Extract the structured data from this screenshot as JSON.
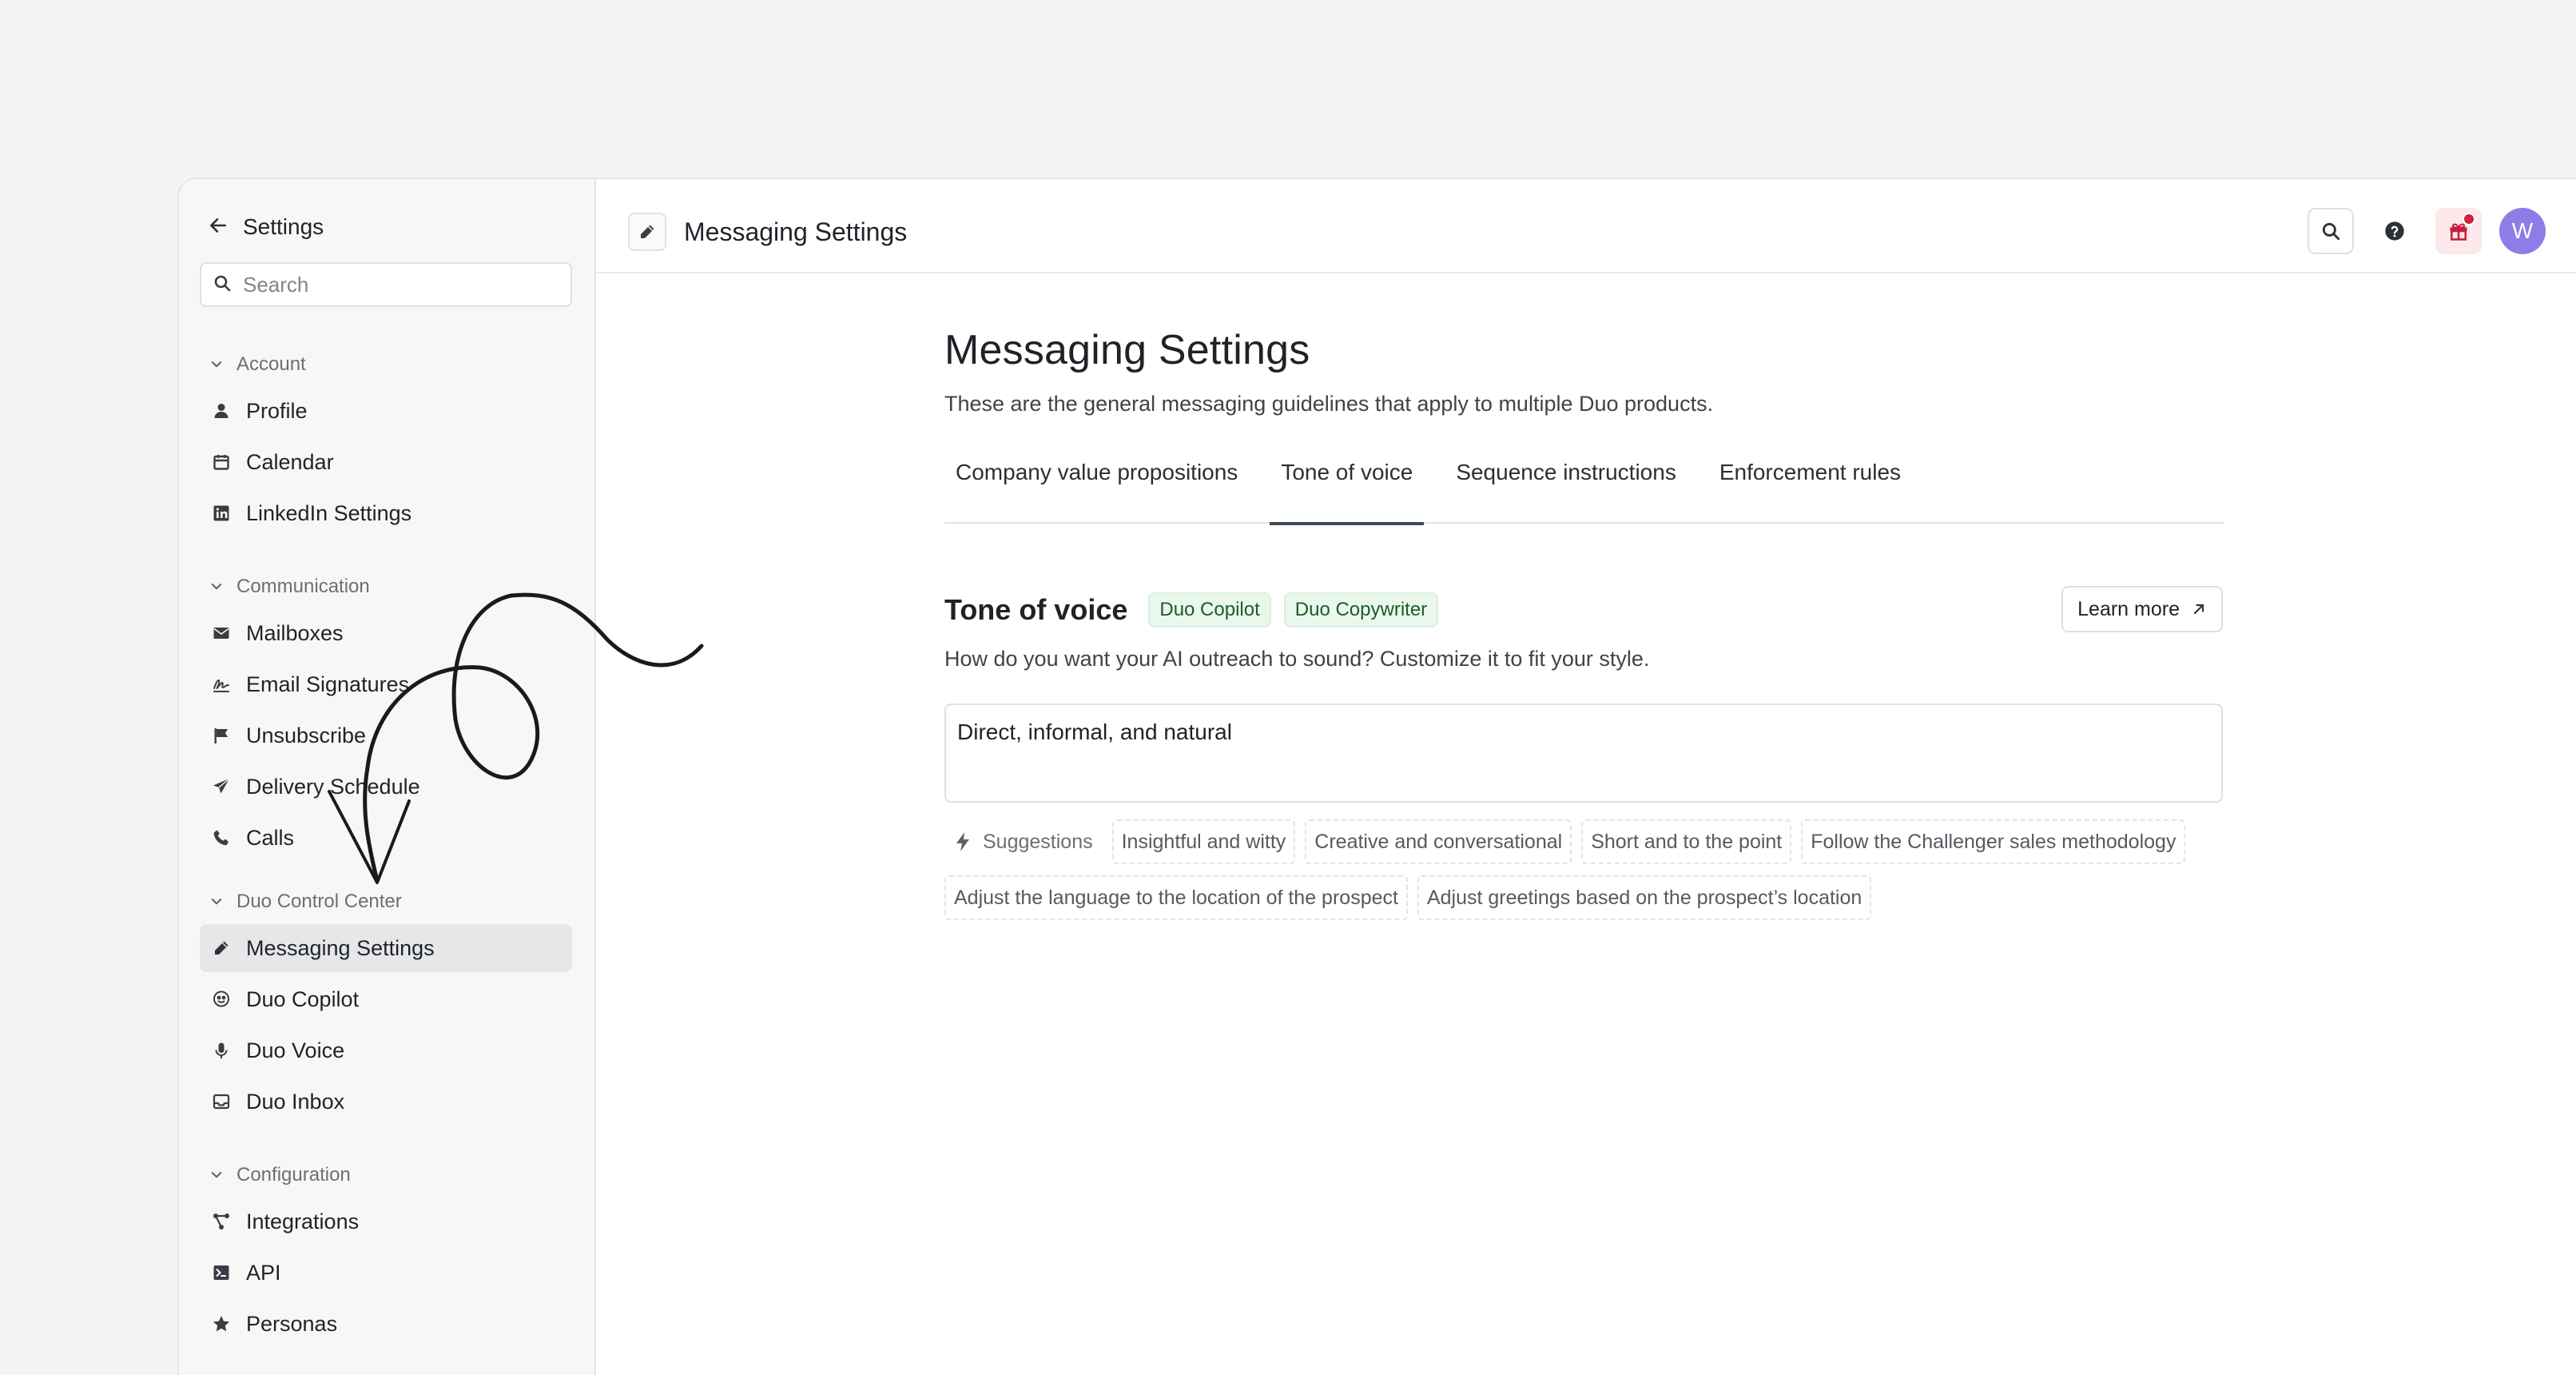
{
  "sidebar": {
    "header_title": "Settings",
    "search_placeholder": "Search",
    "groups": [
      {
        "title": "Account",
        "items": [
          {
            "label": "Profile",
            "icon": "user-icon"
          },
          {
            "label": "Calendar",
            "icon": "calendar-icon"
          },
          {
            "label": "LinkedIn Settings",
            "icon": "linkedin-icon"
          }
        ]
      },
      {
        "title": "Communication",
        "items": [
          {
            "label": "Mailboxes",
            "icon": "envelope-icon"
          },
          {
            "label": "Email Signatures",
            "icon": "signature-icon"
          },
          {
            "label": "Unsubscribe",
            "icon": "flag-icon"
          },
          {
            "label": "Delivery Schedule",
            "icon": "paper-plane-icon"
          },
          {
            "label": "Calls",
            "icon": "phone-icon"
          }
        ]
      },
      {
        "title": "Duo Control Center",
        "items": [
          {
            "label": "Messaging Settings",
            "icon": "pencil-icon",
            "active": true
          },
          {
            "label": "Duo Copilot",
            "icon": "copilot-icon"
          },
          {
            "label": "Duo Voice",
            "icon": "microphone-icon"
          },
          {
            "label": "Duo Inbox",
            "icon": "inbox-icon"
          }
        ]
      },
      {
        "title": "Configuration",
        "items": [
          {
            "label": "Integrations",
            "icon": "integrations-icon"
          },
          {
            "label": "API",
            "icon": "terminal-icon"
          },
          {
            "label": "Personas",
            "icon": "star-icon"
          }
        ]
      }
    ]
  },
  "topbar": {
    "title": "Messaging Settings",
    "avatar_initial": "W",
    "accent_color": "#8c7ee6",
    "notification_color": "#d0223a"
  },
  "main": {
    "title": "Messaging Settings",
    "subtitle": "These are the general messaging guidelines that apply to multiple Duo products.",
    "tabs": [
      {
        "label": "Company value propositions"
      },
      {
        "label": "Tone of voice",
        "active": true
      },
      {
        "label": "Sequence instructions"
      },
      {
        "label": "Enforcement rules"
      }
    ],
    "section": {
      "title": "Tone of voice",
      "badges": [
        "Duo Copilot",
        "Duo Copywriter"
      ],
      "learn_more": "Learn more",
      "description": "How do you want your AI outreach to sound? Customize it to fit your style.",
      "input_value": "Direct, informal, and natural",
      "suggestions_label": "Suggestions",
      "suggestions": [
        "Insightful and witty",
        "Creative and conversational",
        "Short and to the point",
        "Follow the Challenger sales methodology",
        "Adjust the language to the location of the prospect",
        "Adjust greetings based on the prospect’s location"
      ]
    }
  }
}
